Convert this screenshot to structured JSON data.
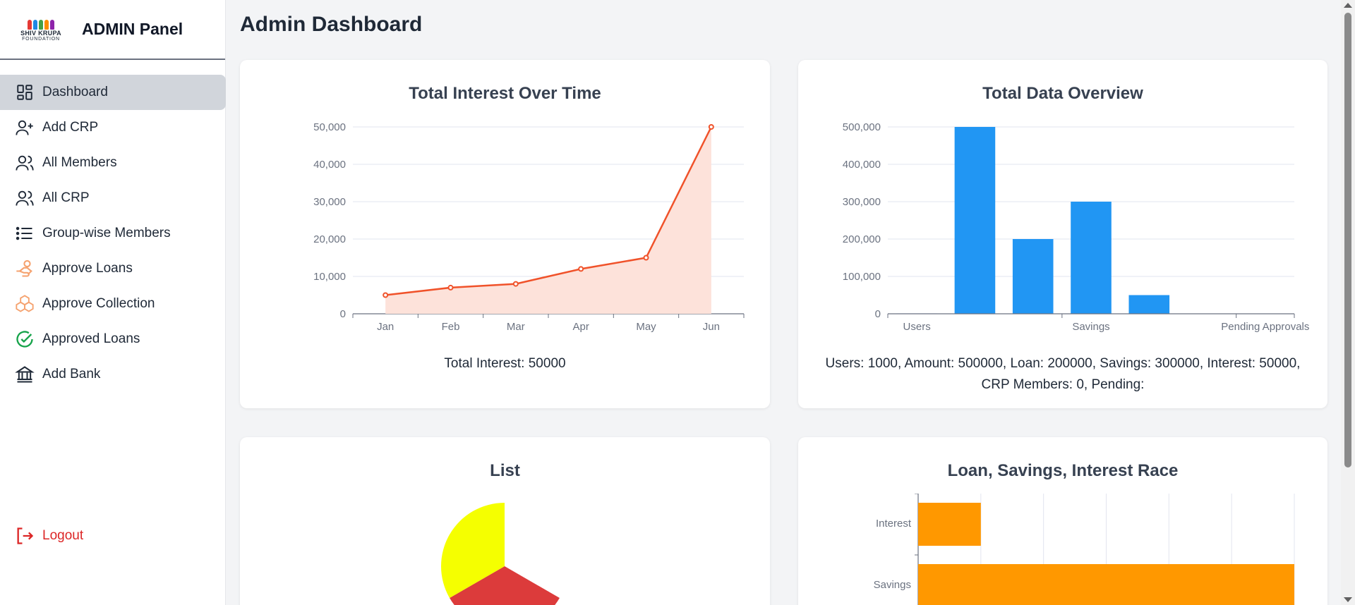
{
  "brand": {
    "logo_line1": "SHIV KRUPA",
    "logo_line2": "FOUNDATION",
    "title": "ADMIN Panel"
  },
  "sidebar": {
    "items": [
      {
        "label": "Dashboard",
        "icon": "dashboard-grid-icon",
        "active": true
      },
      {
        "label": "Add CRP",
        "icon": "user-plus-icon"
      },
      {
        "label": "All Members",
        "icon": "users-icon"
      },
      {
        "label": "All CRP",
        "icon": "users-icon"
      },
      {
        "label": "Group-wise Members",
        "icon": "list-icon"
      },
      {
        "label": "Approve Loans",
        "icon": "hand-coins-icon"
      },
      {
        "label": "Approve Collection",
        "icon": "boxes-icon"
      },
      {
        "label": "Approved Loans",
        "icon": "check-circle-icon"
      },
      {
        "label": "Add Bank",
        "icon": "bank-icon"
      }
    ],
    "logout": "Logout"
  },
  "page": {
    "title": "Admin Dashboard"
  },
  "cards": {
    "interest": {
      "title": "Total Interest Over Time",
      "caption": "Total Interest: 50000"
    },
    "overview": {
      "title": "Total Data Overview",
      "caption_line1": "Users: 1000, Amount: 500000, Loan: 200000, Savings: 300000, Interest: 50000,",
      "caption_line2": "CRP Members: 0, Pending:"
    },
    "list": {
      "title": "List"
    },
    "race": {
      "title": "Loan, Savings, Interest Race"
    }
  },
  "colors": {
    "line": "#f0522a",
    "area": "#fde2da",
    "bar": "#2196f3",
    "race_bar": "#ff9800",
    "pie_yellow": "#f5ff00",
    "pie_red": "#dc3b3b",
    "logout": "#dc2626"
  },
  "chart_data": [
    {
      "type": "area",
      "title": "Total Interest Over Time",
      "categories": [
        "Jan",
        "Feb",
        "Mar",
        "Apr",
        "May",
        "Jun"
      ],
      "values": [
        5000,
        7000,
        8000,
        12000,
        15000,
        50000
      ],
      "ylim": [
        0,
        50000
      ],
      "yticks": [
        "0",
        "10,000",
        "20,000",
        "30,000",
        "40,000",
        "50,000"
      ],
      "grid": true
    },
    {
      "type": "bar",
      "title": "Total Data Overview",
      "categories": [
        "Users",
        "Amount",
        "Loan",
        "Savings",
        "Interest",
        "CRP Members",
        "Pending Approvals"
      ],
      "tick_labels_shown": [
        "Users",
        "Savings",
        "Pending Approvals"
      ],
      "values": [
        1000,
        500000,
        200000,
        300000,
        50000,
        0,
        0
      ],
      "ylim": [
        0,
        500000
      ],
      "yticks": [
        "0",
        "100,000",
        "200,000",
        "300,000",
        "400,000",
        "500,000"
      ],
      "grid": true
    },
    {
      "type": "pie",
      "title": "List",
      "slices": [
        {
          "color": "#f5ff00"
        },
        {
          "color": "#dc3b3b"
        }
      ]
    },
    {
      "type": "bar",
      "orientation": "horizontal",
      "title": "Loan, Savings, Interest Race",
      "categories": [
        "Interest",
        "Savings"
      ],
      "values": [
        50000,
        300000
      ],
      "xlim": [
        0,
        300000
      ],
      "grid": true
    }
  ]
}
